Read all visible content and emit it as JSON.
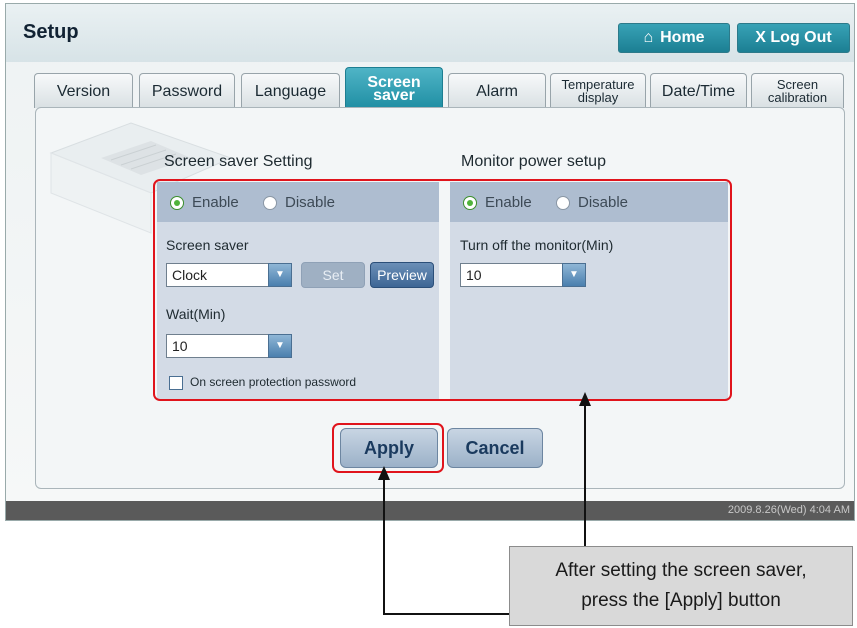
{
  "header": {
    "title": "Setup",
    "home_label": "Home",
    "logout_label": "X Log Out"
  },
  "tabs": [
    {
      "label": "Version"
    },
    {
      "label": "Password"
    },
    {
      "label": "Language"
    },
    {
      "label_line1": "Screen",
      "label_line2": "saver",
      "active": true
    },
    {
      "label": "Alarm"
    },
    {
      "label_line1": "Temperature",
      "label_line2": "display"
    },
    {
      "label": "Date/Time"
    },
    {
      "label_line1": "Screen",
      "label_line2": "calibration"
    }
  ],
  "screensaver": {
    "title": "Screen saver Setting",
    "enable_label": "Enable",
    "disable_label": "Disable",
    "selected": "Enable",
    "screen_saver_label": "Screen saver",
    "screen_saver_value": "Clock",
    "set_label": "Set",
    "preview_label": "Preview",
    "wait_label": "Wait(Min)",
    "wait_value": "10",
    "password_label": "On screen protection password",
    "password_checked": false
  },
  "monitor": {
    "title": "Monitor power setup",
    "enable_label": "Enable",
    "disable_label": "Disable",
    "selected": "Enable",
    "turnoff_label": "Turn off the monitor(Min)",
    "turnoff_value": "10"
  },
  "actions": {
    "apply_label": "Apply",
    "cancel_label": "Cancel"
  },
  "status": {
    "datetime": "2009.8.26(Wed)  4:04 AM"
  },
  "callout": {
    "line1": "After setting the screen saver,",
    "line2": "press the [Apply] button"
  },
  "colors": {
    "accent": "#1f8ea3",
    "highlight": "#e0141c",
    "section_bg": "#d3dbe6"
  }
}
